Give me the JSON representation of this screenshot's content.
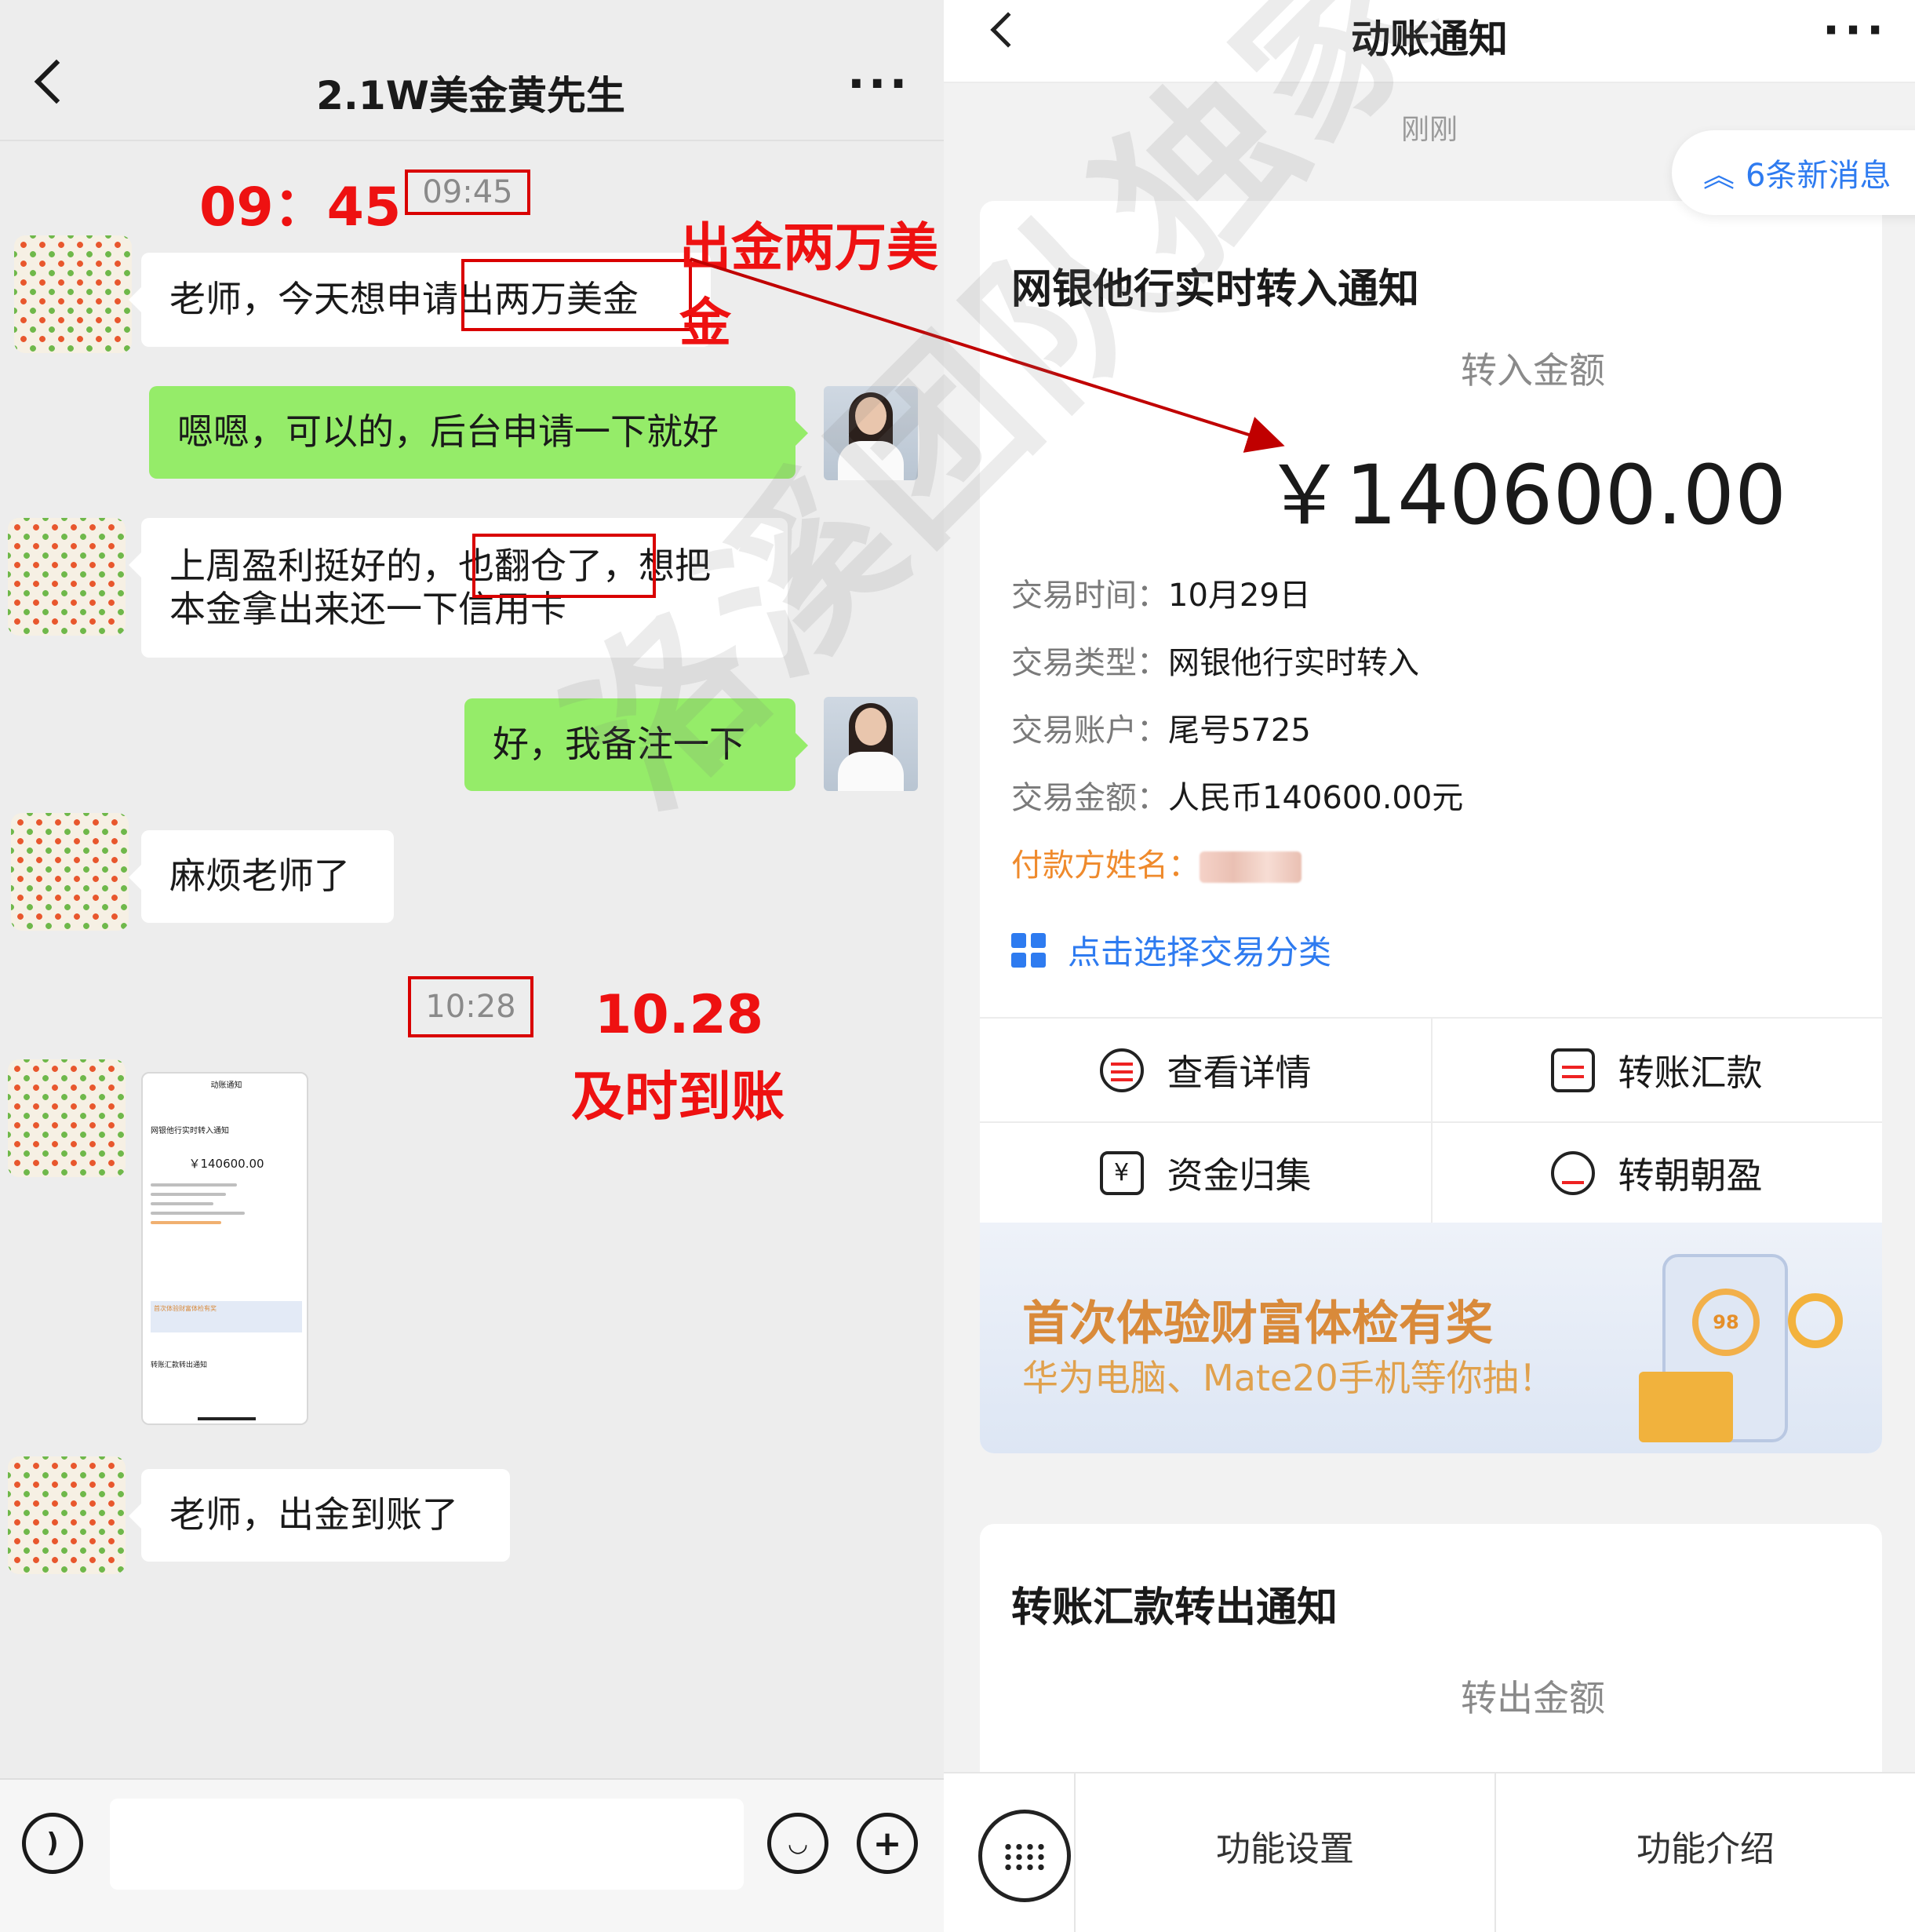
{
  "chat": {
    "title": "2.1W美金黄先生",
    "more": "···",
    "annotation_time_1": "09：45",
    "timestamp_1": "09:45",
    "annotation_withdraw": "出金两万美金",
    "messages": [
      {
        "side": "in",
        "text": "老师，今天想申请出两万美金"
      },
      {
        "side": "out",
        "text": "嗯嗯，可以的，后台申请一下就好"
      },
      {
        "side": "in",
        "line1": "上周盈利挺好的，也翻仓了，想把",
        "line2": "本金拿出来还一下信用卡"
      },
      {
        "side": "out",
        "text": "好，我备注一下"
      },
      {
        "side": "in",
        "text": "麻烦老师了"
      },
      {
        "side": "in",
        "text": "老师，出金到账了"
      }
    ],
    "timestamp_2": "10:28",
    "annotation_date_2": "10.28",
    "annotation_arrived": "及时到账",
    "thumbnail": {
      "title": "动账通知",
      "card_title": "网银他行实时转入通知",
      "amount": "￥140600.00",
      "promo": "首次体验财富体检有奖",
      "card2_title": "转账汇款转出通知"
    }
  },
  "bank": {
    "title": "动账通知",
    "more": "···",
    "time": "刚刚",
    "new_messages": "6条新消息",
    "card": {
      "title": "网银他行实时转入通知",
      "amount_label": "转入金额",
      "amount": "￥140600.00",
      "rows": [
        {
          "key": "交易时间：",
          "value": "10月29日"
        },
        {
          "key": "交易类型：",
          "value": "网银他行实时转入"
        },
        {
          "key": "交易账户：",
          "value": "尾号5725"
        },
        {
          "key": "交易金额：",
          "value": "人民币140600.00元"
        }
      ],
      "payer_key": "付款方姓名：",
      "classify": "点击选择交易分类",
      "actions": [
        "查看详情",
        "转账汇款",
        "资金归集",
        "转朝朝盈"
      ]
    },
    "banner": {
      "title": "首次体验财富体检有奖",
      "subtitle": "华为电脑、Mate20手机等你抽！",
      "gauge_value": "98"
    },
    "card2": {
      "title": "转账汇款转出通知",
      "amount_label": "转出金额"
    },
    "bottom": {
      "btn1": "功能设置",
      "btn2": "功能介绍"
    }
  },
  "watermark": "洛溪团队独家",
  "colors": {
    "wechat_green": "#95ec69",
    "annotation_red": "#e11111",
    "bank_blue": "#2e7bf0",
    "bank_orange": "#ef8a2c"
  }
}
